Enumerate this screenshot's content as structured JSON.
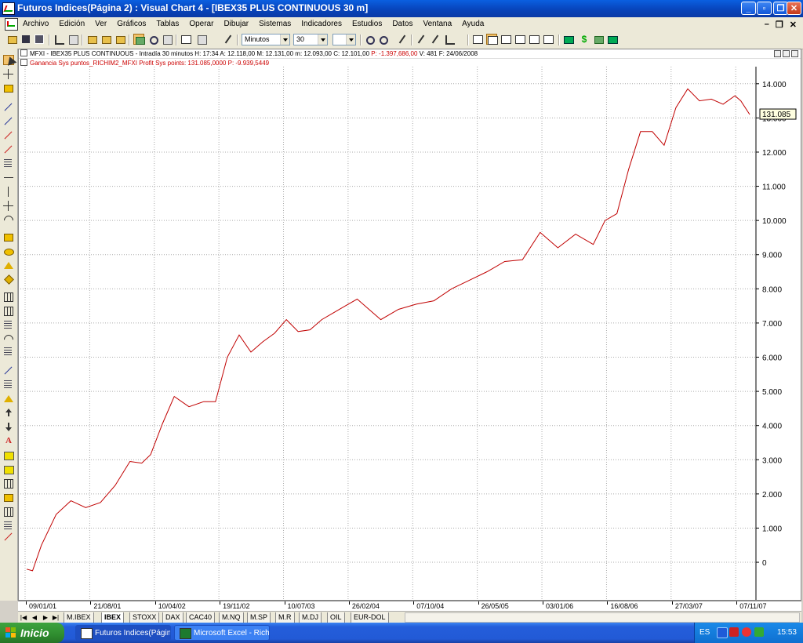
{
  "window": {
    "title": "Futuros Indices(Página 2) : Visual Chart 4 - [IBEX35 PLUS CONTINUOUS 30 m]"
  },
  "menu": {
    "items": [
      "Archivo",
      "Edición",
      "Ver",
      "Gráficos",
      "Tablas",
      "Operar",
      "Dibujar",
      "Sistemas",
      "Indicadores",
      "Estudios",
      "Datos",
      "Ventana",
      "Ayuda"
    ]
  },
  "toolbar": {
    "period_unit": "Minutos",
    "period_value": "30"
  },
  "chart": {
    "info_line": "MFXI - IBEX35 PLUS CONTINUOUS - Intradía 30 minutos",
    "info_h": "H: 17:34",
    "info_a": "A: 12.118,00",
    "info_m": "M: 12.131,00",
    "info_mn": "m: 12.093,00",
    "info_c": "C: 12.101,00",
    "info_p": "P: -1.397,686,00",
    "info_v": "V: 481",
    "info_f": "F: 24/06/2008",
    "indicator_line": "Ganancia Sys puntos_RICHIM2_MFXI",
    "indicator_value": "Profit Sys points: 131.085,0000",
    "indicator_p": "P: -9.939,5449",
    "last_value_tag": "131.085",
    "line_color": "#c00000"
  },
  "chart_data": {
    "type": "line",
    "title": "",
    "xlabel": "",
    "ylabel": "",
    "yticks": [
      "0",
      "1.000",
      "2.000",
      "3.000",
      "4.000",
      "5.000",
      "6.000",
      "7.000",
      "8.000",
      "9.000",
      "10.000",
      "11.000",
      "12.000",
      "13.000",
      "14.000"
    ],
    "ylim": [
      -1100,
      14500
    ],
    "xticks": [
      "09/01/01",
      "21/08/01",
      "10/04/02",
      "19/11/02",
      "10/07/03",
      "26/02/04",
      "07/10/04",
      "26/05/05",
      "03/01/06",
      "16/08/06",
      "27/03/07",
      "07/11/07"
    ],
    "grid": true,
    "series": [
      {
        "name": "Ganancia Sys puntos_RICHIM2_MFXI",
        "x": [
          0,
          0.1,
          0.25,
          0.5,
          0.75,
          1.0,
          1.25,
          1.5,
          1.75,
          1.95,
          2.1,
          2.3,
          2.5,
          2.75,
          3.0,
          3.2,
          3.4,
          3.6,
          3.8,
          4.0,
          4.2,
          4.4,
          4.6,
          4.8,
          5.0,
          5.2,
          5.4,
          5.6,
          5.8,
          6.0,
          6.3,
          6.6,
          6.9,
          7.2,
          7.5,
          7.8,
          8.1,
          8.4,
          8.7,
          9.0,
          9.3,
          9.6,
          9.8,
          10.0,
          10.2,
          10.4,
          10.6,
          10.8,
          11.0,
          11.2,
          11.4,
          11.6,
          11.8,
          12.0,
          12.1,
          12.25
        ],
        "y": [
          -200,
          -250,
          500,
          1400,
          1800,
          1600,
          1750,
          2250,
          2950,
          2900,
          3150,
          4050,
          4850,
          4550,
          4700,
          4700,
          6000,
          6650,
          6150,
          6450,
          6700,
          7100,
          6750,
          6800,
          7100,
          7300,
          7500,
          7700,
          7400,
          7100,
          7400,
          7550,
          7650,
          8000,
          8250,
          8500,
          8800,
          8850,
          9650,
          9200,
          9600,
          9300,
          10000,
          10200,
          11500,
          12600,
          12600,
          12200,
          13300,
          13850,
          13500,
          13550,
          13400,
          13650,
          13500,
          13100
        ]
      }
    ]
  },
  "tabs": [
    "M.IBEX",
    "IBEX",
    "STOXX",
    "DAX",
    "CAC40",
    "M.NQ",
    "M.SP",
    "M.R",
    "M.DJ",
    "OIL",
    "EUR-DOL"
  ],
  "active_tab": "IBEX",
  "taskbar": {
    "start_label": "Inicio",
    "items": [
      "Futuros Indices(Págin...",
      "Microsoft Excel - Richi..."
    ],
    "lang": "ES",
    "clock": "15:53"
  }
}
